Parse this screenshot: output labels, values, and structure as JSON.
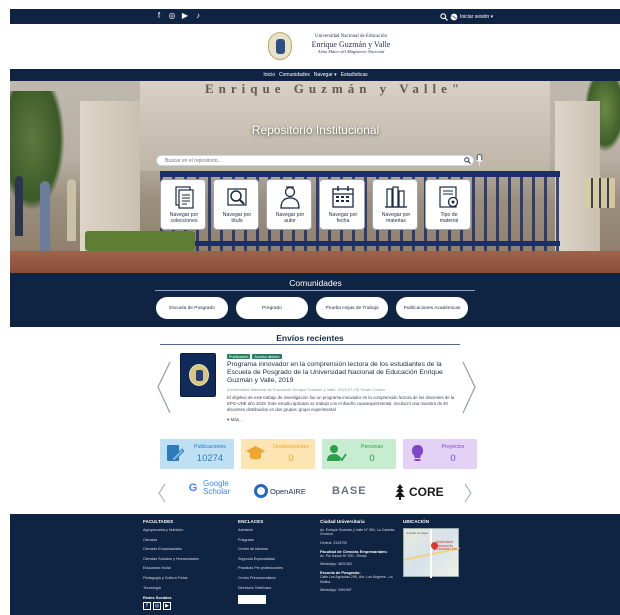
{
  "topbar": {
    "social": [
      "f",
      "◎",
      "▶",
      "♪"
    ],
    "login_label": "Iniciar sesión ▾"
  },
  "brand": {
    "line1": "Universidad Nacional de Educación",
    "line2": "Enrique Guzmán y Valle",
    "line3": "Alma Máter del Magisterio Nacional"
  },
  "nav": {
    "items": [
      "Inicio",
      "Comunidades",
      "Navegar ▾",
      "Estadísticas"
    ]
  },
  "hero": {
    "engraving": "Enrique Guzmán y Valle\"",
    "title": "Repositorio Institucional",
    "search_placeholder": "Buscar en el repositorio..."
  },
  "tiles": [
    {
      "l1": "Navegar por",
      "l2": "colecciones",
      "icon": "document-stack-icon"
    },
    {
      "l1": "Navegar por",
      "l2": "título",
      "icon": "magnifier-book-icon"
    },
    {
      "l1": "Navegar por",
      "l2": "autor",
      "icon": "author-icon"
    },
    {
      "l1": "Navegar por",
      "l2": "fecha",
      "icon": "calendar-icon"
    },
    {
      "l1": "Navegar por",
      "l2": "materias",
      "icon": "books-icon"
    },
    {
      "l1": "Tipo de",
      "l2": "material",
      "icon": "material-type-icon"
    }
  ],
  "communities": {
    "title": "Comunidades",
    "items": [
      "Escuela de Posgrado",
      "Pregrado",
      "Prueba Hojas de Trabajo",
      "Publicaciones Académicas"
    ]
  },
  "recent": {
    "title": "Envíos recientes",
    "badges": [
      "Publicación",
      "Acceso abierto"
    ],
    "item_title": "Programa innovador en la comprensión lectora de los estudiantes de la Escuela de Posgrado de la Universidad Nacional de Educación Enrique Guzmán y Valle, 2019",
    "meta": "(Universidad Nacional de Educación Enrique Guzmán y Valle, 2019-07-29) Prado Cossío",
    "abstract": "El objetivo de este trabajo de investigación fue un programa innovador en la comprensión lectora de los discentes de la EPG-UNE año 2019. Este estudio aplicado se trabajó con el diseño cuasiexperimental, involucró una muestra de 40 discentes distribuidos en dos grupos: grupo experimental",
    "more": "▾ Más..."
  },
  "stats": [
    {
      "label": "Publicaciones",
      "value": "10274",
      "icon": "publications-icon"
    },
    {
      "label": "Organizaciones",
      "value": "0",
      "icon": "organizations-icon"
    },
    {
      "label": "Personas",
      "value": "0",
      "icon": "people-icon"
    },
    {
      "label": "Proyectos",
      "value": "0",
      "icon": "projects-icon"
    }
  ],
  "partners": {
    "google_letter": "G",
    "google_l1": "Google",
    "google_l2": "Scholar",
    "openaire": "OpenAIRE",
    "base": "BASE",
    "core": "CORE"
  },
  "footer": {
    "faculties": {
      "title": "FACULTADES",
      "items": [
        "Agropecuaria y Nutrición",
        "Ciencias",
        "Ciencias Empresariales",
        "Ciencias Sociales y Humanidades",
        "Educación Inicial",
        "Pedagogía y Cultura Física",
        "Tecnología"
      ],
      "social_title": "Redes Sociales"
    },
    "links": {
      "title": "ENCLACES",
      "items": [
        "Admisión",
        "Posgrado",
        "Centro de Idiomas",
        "Segunda Especialidad",
        "Prácticas Pre profesionales",
        "Centro Preuniversitario",
        "Directorio Telefónico"
      ]
    },
    "campus": {
      "title": "Ciudad Universitaria",
      "address1": "Av. Enrique Guzmán y Valle N° 951, La Cantuta-Chosica",
      "phone1": "Central: 3133700",
      "sub2": "Facultad de Ciencias Empresariales:",
      "address2": "Av. Pío Sacón Nº 200 - Rímac",
      "phone2": "WhatsApp: 3821353",
      "sub3": "Escuela de Posgrado:",
      "address3": "Calle Los Agrícolas 295, Urb. Los Ángeles - La Molina",
      "phone3": "WhatsApp: 3491997"
    },
    "location": {
      "title": "UBICACIÓN",
      "map_top": "Ampliar el mapa",
      "map_label": "Universidad Nacional de Educación Enr..."
    }
  }
}
